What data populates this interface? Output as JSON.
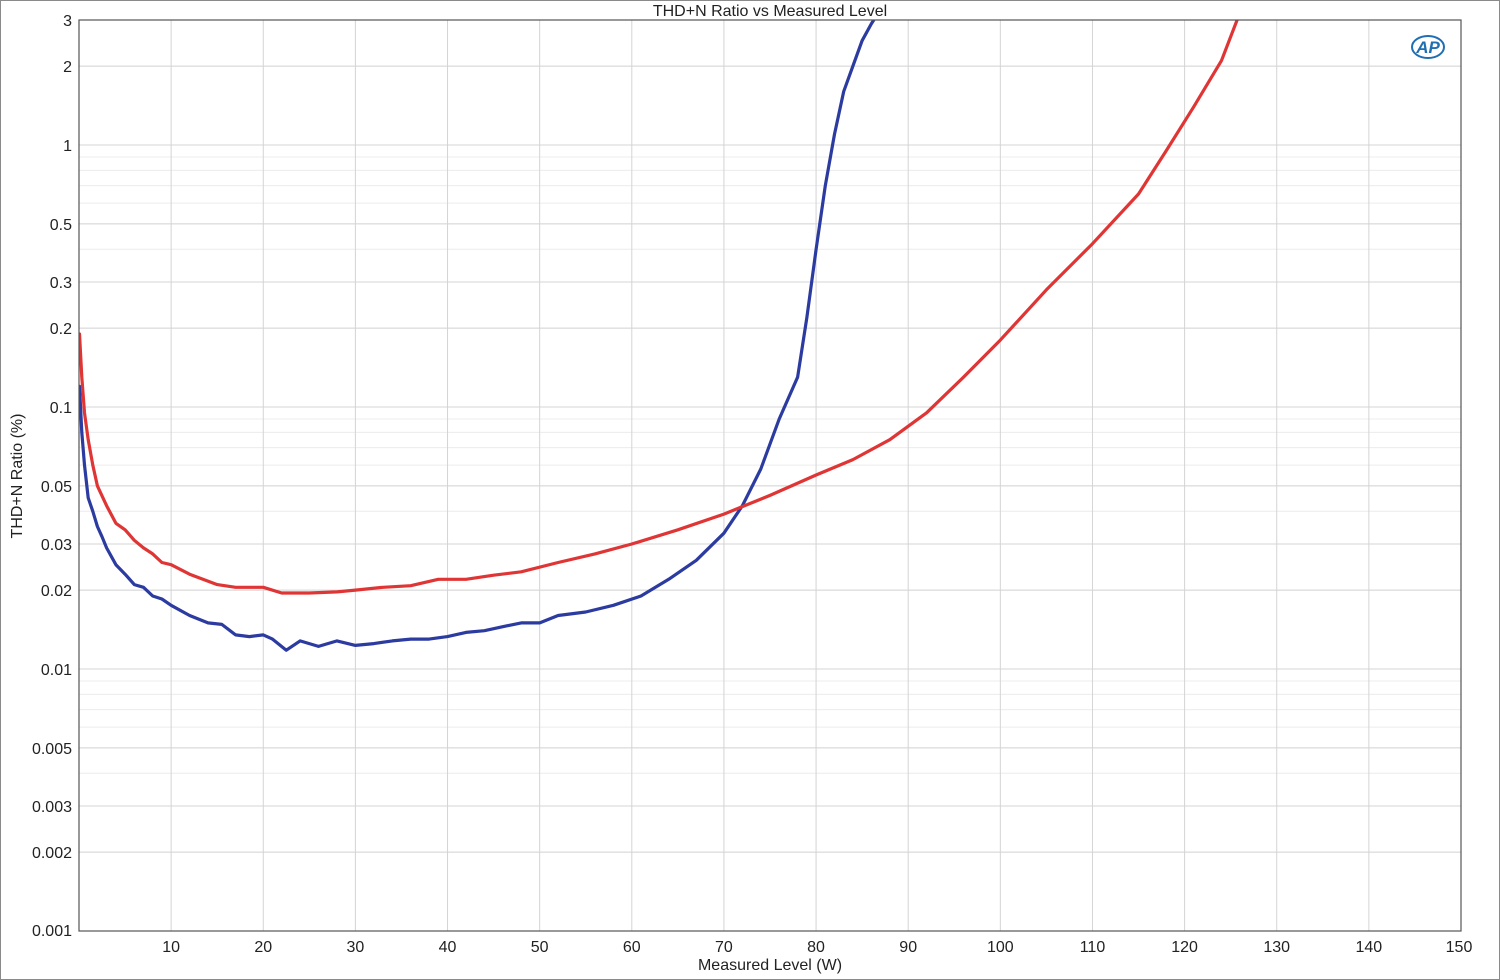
{
  "chart_data": {
    "type": "line",
    "title": "THD+N Ratio vs Measured Level",
    "xlabel": "Measured Level (W)",
    "ylabel": "THD+N Ratio (%)",
    "xlim": [
      0,
      150
    ],
    "ylim": [
      0.001,
      3
    ],
    "y_scale": "log",
    "grid": true,
    "x_ticks": [
      "10",
      "20",
      "30",
      "40",
      "50",
      "60",
      "70",
      "80",
      "90",
      "100",
      "110",
      "120",
      "130",
      "140",
      "150"
    ],
    "y_ticks": [
      "3",
      "2",
      "1",
      "0.5",
      "0.3",
      "0.2",
      "0.1",
      "0.05",
      "0.03",
      "0.02",
      "0.01",
      "0.005",
      "0.003",
      "0.002",
      "0.001"
    ],
    "logo": "AP",
    "series": [
      {
        "color": "#2b3ba0",
        "x": [
          0.05,
          0.3,
          0.6,
          1,
          1.5,
          2,
          2.5,
          3,
          4,
          5,
          6,
          7,
          8,
          9,
          10,
          12,
          14,
          15.5,
          17,
          18.5,
          20,
          21,
          22.5,
          24,
          26,
          28,
          30,
          32,
          34,
          36,
          38,
          40,
          42,
          44,
          46,
          48,
          50,
          52,
          55,
          58,
          61,
          64,
          67,
          70,
          72,
          74,
          76,
          78,
          79,
          80,
          81,
          82,
          83,
          84,
          85,
          86,
          87
        ],
        "y": [
          0.12,
          0.08,
          0.06,
          0.045,
          0.04,
          0.035,
          0.032,
          0.029,
          0.025,
          0.023,
          0.021,
          0.0205,
          0.019,
          0.0185,
          0.0175,
          0.016,
          0.015,
          0.0148,
          0.0135,
          0.0133,
          0.0135,
          0.013,
          0.0118,
          0.0128,
          0.0122,
          0.0128,
          0.0123,
          0.0125,
          0.0128,
          0.013,
          0.013,
          0.0133,
          0.0138,
          0.014,
          0.0145,
          0.015,
          0.015,
          0.016,
          0.0165,
          0.0175,
          0.019,
          0.022,
          0.026,
          0.033,
          0.042,
          0.058,
          0.09,
          0.13,
          0.22,
          0.4,
          0.7,
          1.1,
          1.6,
          2.0,
          2.5,
          2.9,
          3.3
        ]
      },
      {
        "color": "#e03535",
        "x": [
          0.05,
          0.3,
          0.6,
          1,
          1.5,
          2,
          3,
          4,
          5,
          6,
          7,
          8,
          9,
          10,
          12,
          15,
          17,
          20,
          22,
          25,
          28,
          30,
          33,
          36,
          39,
          42,
          45,
          48,
          52,
          56,
          60,
          65,
          70,
          75,
          80,
          84,
          88,
          92,
          96,
          100,
          105,
          110,
          115,
          118,
          121,
          124,
          126
        ],
        "y": [
          0.19,
          0.13,
          0.095,
          0.075,
          0.06,
          0.05,
          0.042,
          0.036,
          0.034,
          0.031,
          0.029,
          0.0275,
          0.0255,
          0.025,
          0.023,
          0.021,
          0.0205,
          0.0205,
          0.0195,
          0.0195,
          0.0197,
          0.02,
          0.0205,
          0.0208,
          0.022,
          0.022,
          0.0228,
          0.0235,
          0.0255,
          0.0275,
          0.03,
          0.034,
          0.039,
          0.046,
          0.055,
          0.063,
          0.075,
          0.095,
          0.13,
          0.18,
          0.28,
          0.42,
          0.65,
          0.95,
          1.4,
          2.1,
          3.2
        ]
      }
    ]
  }
}
